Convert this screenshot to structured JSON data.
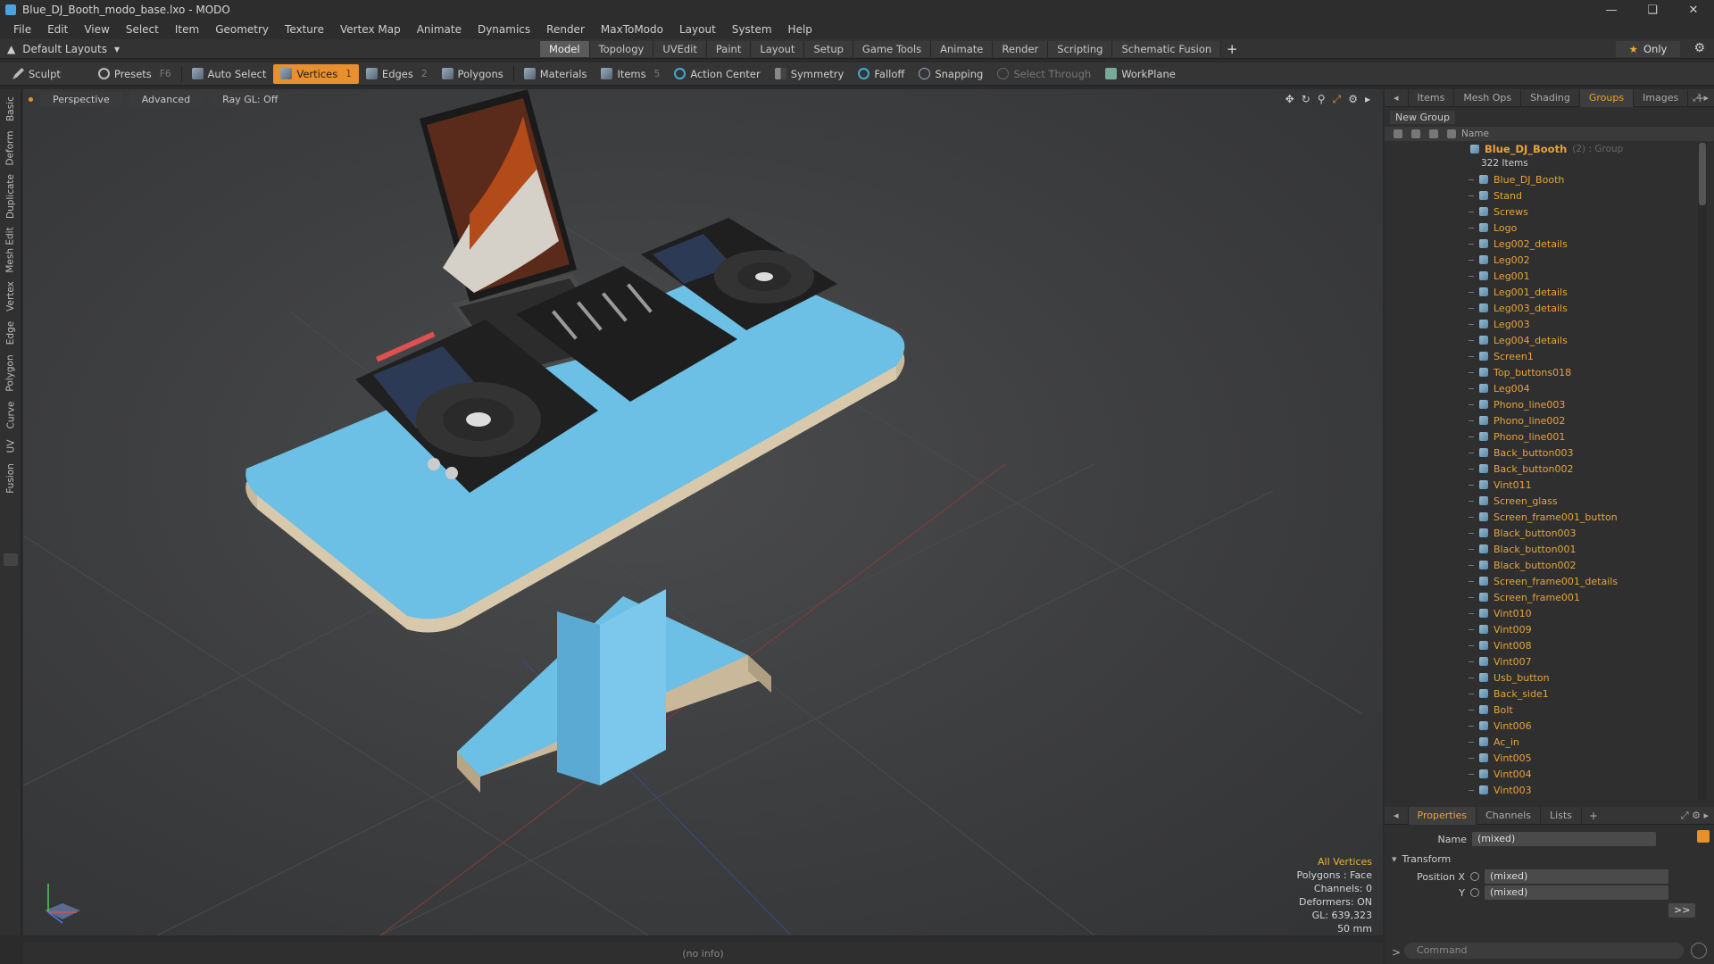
{
  "window": {
    "title": "Blue_DJ_Booth_modo_base.lxo - MODO"
  },
  "menu": [
    "File",
    "Edit",
    "View",
    "Select",
    "Item",
    "Geometry",
    "Texture",
    "Vertex Map",
    "Animate",
    "Dynamics",
    "Render",
    "MaxToModo",
    "Layout",
    "System",
    "Help"
  ],
  "layout": {
    "dropdown": "Default Layouts",
    "tabs": [
      "Model",
      "Topology",
      "UVEdit",
      "Paint",
      "Layout",
      "Setup",
      "Game Tools",
      "Animate",
      "Render",
      "Scripting",
      "Schematic Fusion"
    ],
    "active_tab": "Model",
    "only_label": "Only"
  },
  "toolbar": {
    "sculpt": "Sculpt",
    "presets": "Presets",
    "presets_key": "F6",
    "auto_select": "Auto Select",
    "vertices": "Vertices",
    "vertices_count": "1",
    "edges": "Edges",
    "edges_count": "2",
    "polygons": "Polygons",
    "materials": "Materials",
    "items": "Items",
    "items_count": "5",
    "action_center": "Action Center",
    "symmetry": "Symmetry",
    "falloff": "Falloff",
    "snapping": "Snapping",
    "select_through": "Select Through",
    "workplane": "WorkPlane"
  },
  "left_tabs": [
    "Basic",
    "Deform",
    "Duplicate",
    "Mesh Edit",
    "Vertex",
    "Edge",
    "Polygon",
    "Curve",
    "UV",
    "Fusion"
  ],
  "viewport": {
    "view": "Perspective",
    "shading": "Advanced",
    "raygl": "Ray GL: Off",
    "stats": {
      "mode": "All Vertices",
      "polygons": "Polygons : Face",
      "channels": "Channels: 0",
      "deformers": "Deformers: ON",
      "gl": "GL: 639,323",
      "size": "50 mm"
    }
  },
  "status": {
    "info": "(no info)"
  },
  "panel": {
    "tabs": [
      "Items",
      "Mesh Ops",
      "Shading",
      "Groups",
      "Images"
    ],
    "active_tab": "Groups",
    "new_group": "New Group",
    "name_col": "Name",
    "group_name": "Blue_DJ_Booth",
    "group_info": "(2) : Group",
    "group_count": "322 Items",
    "items": [
      "Blue_DJ_Booth",
      "Stand",
      "Screws",
      "Logo",
      "Leg002_details",
      "Leg002",
      "Leg001",
      "Leg001_details",
      "Leg003_details",
      "Leg003",
      "Leg004_details",
      "Screen1",
      "Top_buttons018",
      "Leg004",
      "Phono_line003",
      "Phono_line002",
      "Phono_line001",
      "Back_button003",
      "Back_button002",
      "Vint011",
      "Screen_glass",
      "Screen_frame001_button",
      "Black_button003",
      "Black_button001",
      "Black_button002",
      "Screen_frame001_details",
      "Screen_frame001",
      "Vint010",
      "Vint009",
      "Vint008",
      "Vint007",
      "Usb_button",
      "Back_side1",
      "Bolt",
      "Vint006",
      "Ac_in",
      "Vint005",
      "Vint004",
      "Vint003"
    ]
  },
  "properties": {
    "tabs": [
      "Properties",
      "Channels",
      "Lists"
    ],
    "active_tab": "Properties",
    "name_label": "Name",
    "name_value": "(mixed)",
    "section": "Transform",
    "pos_x_label": "Position X",
    "pos_x_value": "(mixed)",
    "pos_y_label": "Y",
    "pos_y_value": "(mixed)",
    "more": ">>"
  },
  "command": {
    "placeholder": "Command",
    "prompt": ">"
  },
  "colors": {
    "accent": "#e8902e",
    "item_text": "#e8a33a",
    "booth_blue": "#6cc0e5",
    "viewport_bg": "#3c3d3f"
  }
}
